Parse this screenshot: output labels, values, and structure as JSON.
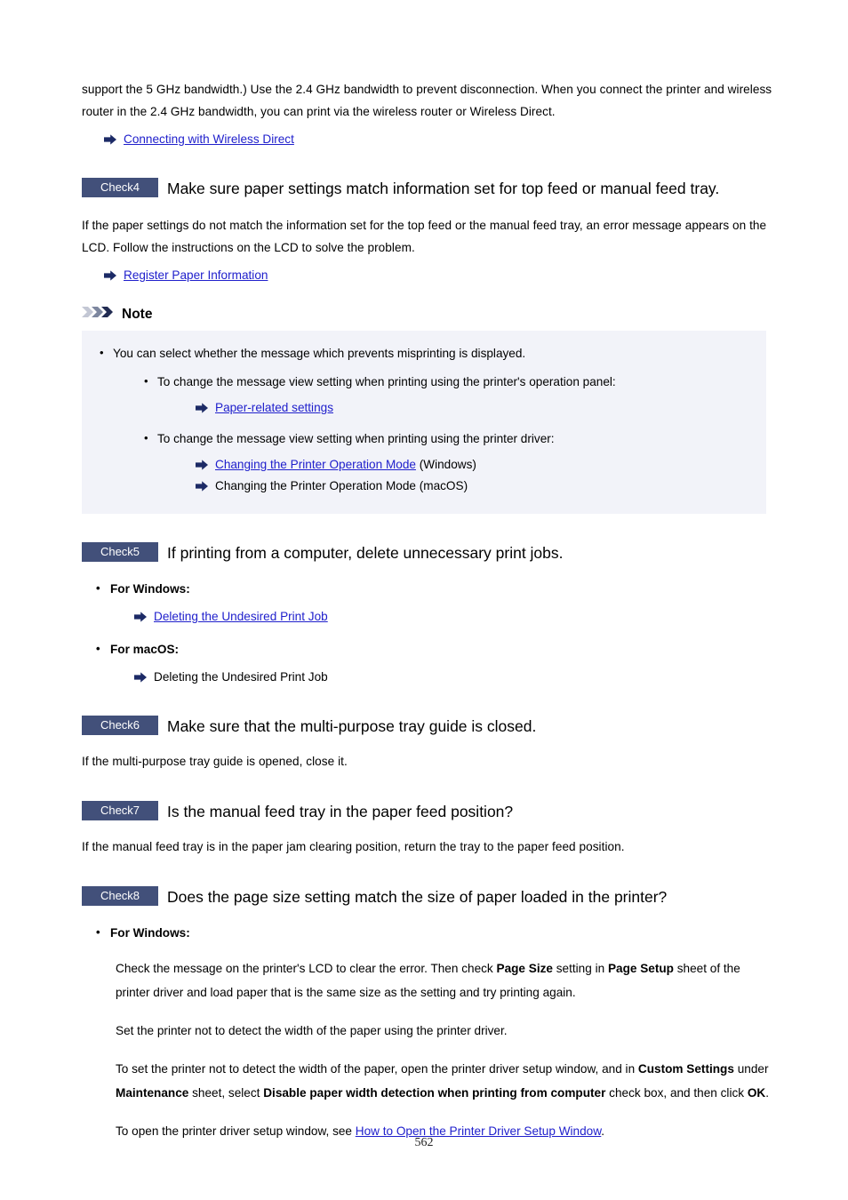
{
  "page": {
    "number": "562"
  },
  "intro": {
    "paragraph": "support the 5 GHz bandwidth.) Use the 2.4 GHz bandwidth to prevent disconnection. When you connect the printer and wireless router in the 2.4 GHz bandwidth, you can print via the wireless router or Wireless Direct.",
    "link": "Connecting with Wireless Direct"
  },
  "check4": {
    "badge": "Check4",
    "title": "Make sure paper settings match information set for top feed or manual feed tray.",
    "body": "If the paper settings do not match the information set for the top feed or the manual feed tray, an error message appears on the LCD. Follow the instructions on the LCD to solve the problem.",
    "link": "Register Paper Information"
  },
  "note": {
    "label": "Note",
    "item1": "You can select whether the message which prevents misprinting is displayed.",
    "sub1": "To change the message view setting when printing using the printer's operation panel:",
    "sub1_link": "Paper-related settings",
    "sub2": "To change the message view setting when printing using the printer driver:",
    "sub2_link_windows": "Changing the Printer Operation Mode",
    "sub2_link_windows_suffix": " (Windows)",
    "sub2_macos": "Changing the Printer Operation Mode (macOS)"
  },
  "check5": {
    "badge": "Check5",
    "title": "If printing from a computer, delete unnecessary print jobs.",
    "windows_label": "For Windows:",
    "windows_link": "Deleting the Undesired Print Job",
    "macos_label": "For macOS:",
    "macos_text": "Deleting the Undesired Print Job"
  },
  "check6": {
    "badge": "Check6",
    "title": "Make sure that the multi-purpose tray guide is closed.",
    "body": "If the multi-purpose tray guide is opened, close it."
  },
  "check7": {
    "badge": "Check7",
    "title": "Is the manual feed tray in the paper feed position?",
    "body": "If the manual feed tray is in the paper jam clearing position, return the tray to the paper feed position."
  },
  "check8": {
    "badge": "Check8",
    "title": "Does the page size setting match the size of paper loaded in the printer?",
    "windows_label": "For Windows:",
    "p1_a": "Check the message on the printer's LCD to clear the error. Then check ",
    "p1_b": "Page Size",
    "p1_c": " setting in ",
    "p1_d": "Page Setup",
    "p1_e": " sheet of the printer driver and load paper that is the same size as the setting and try printing again.",
    "p2": "Set the printer not to detect the width of the paper using the printer driver.",
    "p3_a": "To set the printer not to detect the width of the paper, open the printer driver setup window, and in ",
    "p3_b": "Custom Settings",
    "p3_c": " under ",
    "p3_d": "Maintenance",
    "p3_e": " sheet, select ",
    "p3_f": "Disable paper width detection when printing from computer",
    "p3_g": " check box, and then click ",
    "p3_h": "OK",
    "p3_i": ".",
    "p4_a": "To open the printer driver setup window, see ",
    "p4_link": "How to Open the Printer Driver Setup Window",
    "p4_b": "."
  },
  "colors": {
    "badge_bg": "#42507a",
    "note_bg": "#f2f3f9",
    "link": "#2020cc",
    "arrow": "#1c2a66"
  }
}
